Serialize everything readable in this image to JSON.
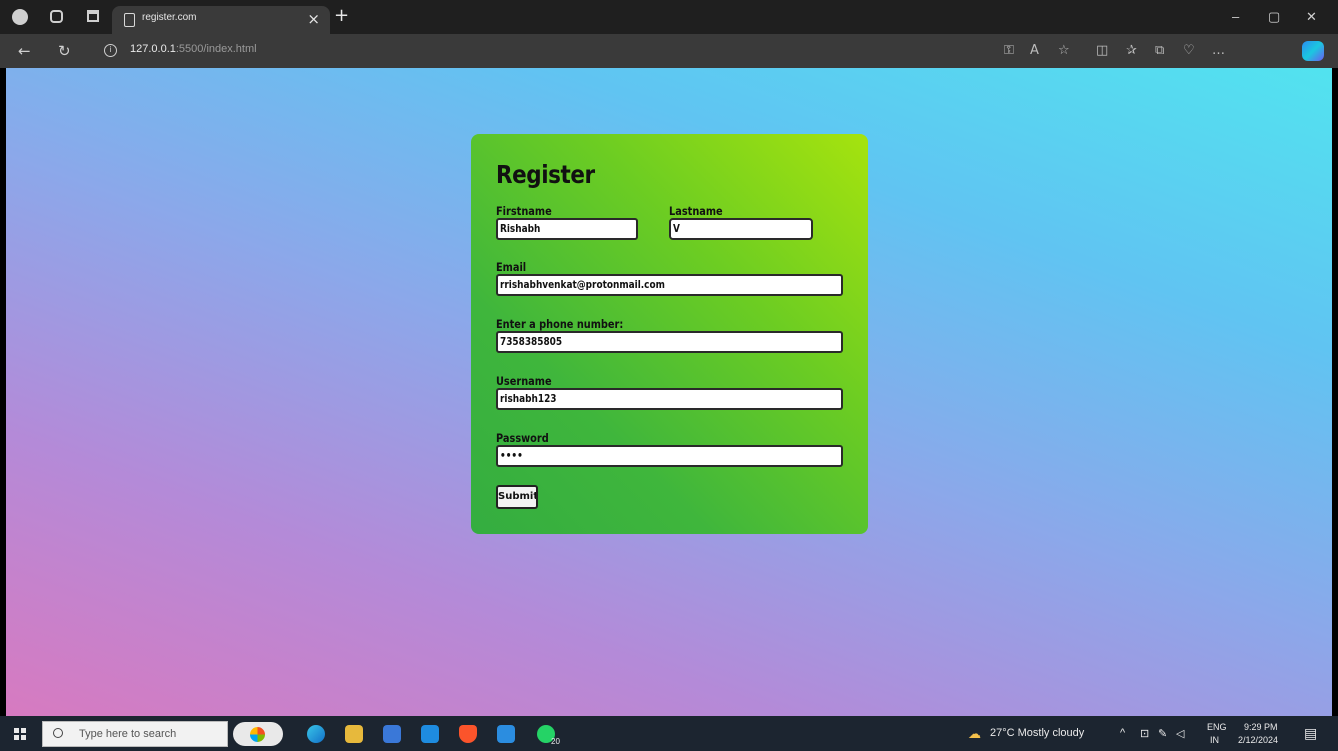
{
  "browser": {
    "tab_title": "register.com",
    "tab_close": "×",
    "new_tab": "+",
    "url_host": "127.0.0.1",
    "url_path": ":5500/index.html",
    "window_controls": {
      "minimize": "–",
      "restore": "▢",
      "close": "✕"
    }
  },
  "form": {
    "heading": "Register",
    "firstname": {
      "label": "Firstname",
      "value": "Rishabh"
    },
    "lastname": {
      "label": "Lastname",
      "value": "V"
    },
    "email": {
      "label": "Email",
      "value": "rrishabhvenkat@protonmail.com"
    },
    "phone": {
      "label": "Enter a phone number:",
      "value": "7358385805"
    },
    "username": {
      "label": "Username",
      "value": "rishabh123"
    },
    "password": {
      "label": "Password",
      "value": "••••"
    },
    "submit_label": "Submit"
  },
  "taskbar": {
    "search_placeholder": "Type here to search",
    "whatsapp_badge": "20",
    "weather": "27°C  Mostly cloudy",
    "lang_top": "ENG",
    "lang_bottom": "IN",
    "time": "9:29 PM",
    "date": "2/12/2024"
  }
}
